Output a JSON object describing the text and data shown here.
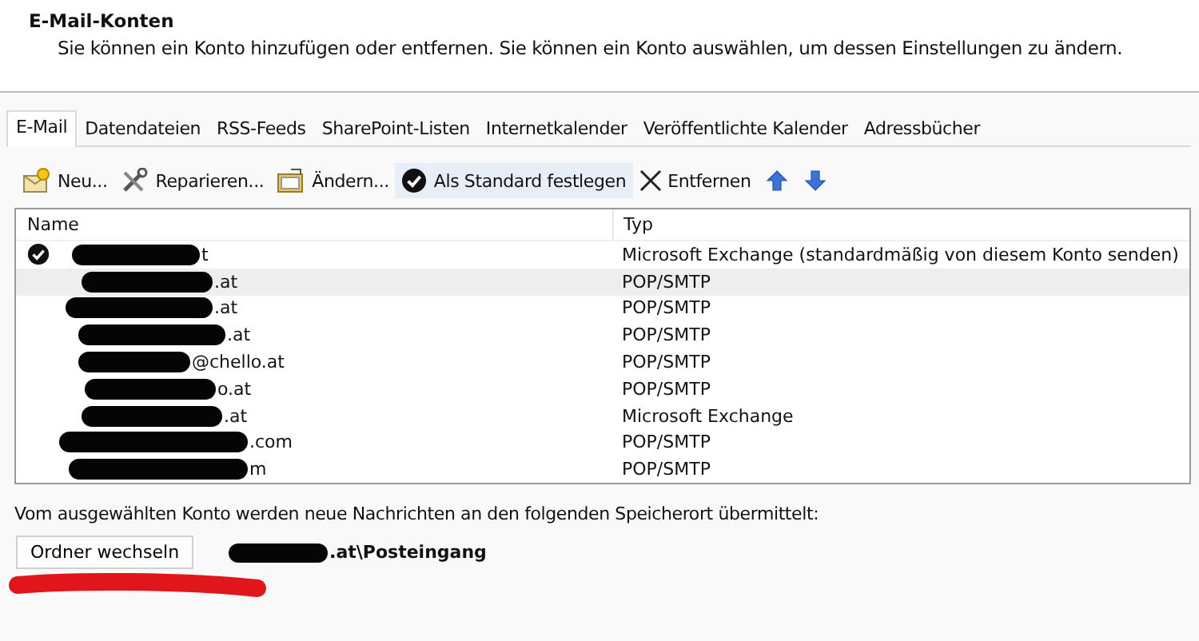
{
  "header": {
    "title": "E-Mail-Konten",
    "description": "Sie können ein Konto hinzufügen oder entfernen. Sie können ein Konto auswählen, um dessen Einstellungen zu ändern."
  },
  "tabs": [
    {
      "label": "E-Mail",
      "selected": true
    },
    {
      "label": "Datendateien",
      "selected": false
    },
    {
      "label": "RSS-Feeds",
      "selected": false
    },
    {
      "label": "SharePoint-Listen",
      "selected": false
    },
    {
      "label": "Internetkalender",
      "selected": false
    },
    {
      "label": "Veröffentlichte Kalender",
      "selected": false
    },
    {
      "label": "Adressbücher",
      "selected": false
    }
  ],
  "toolbar": [
    {
      "kind": "new",
      "label": "Neu..."
    },
    {
      "kind": "repair",
      "label": "Reparieren..."
    },
    {
      "kind": "change",
      "label": "Ändern..."
    },
    {
      "kind": "default",
      "label": "Als Standard festlegen"
    },
    {
      "kind": "remove",
      "label": "Entfernen"
    },
    {
      "kind": "up"
    },
    {
      "kind": "down"
    }
  ],
  "table": {
    "columns": [
      "Name",
      "Typ"
    ],
    "rows": [
      {
        "name": "t",
        "type": "Microsoft Exchange (standardmäßig von diesem Konto senden)",
        "default": true,
        "selected": false
      },
      {
        "name": ".at",
        "type": "POP/SMTP",
        "default": false,
        "selected": true
      },
      {
        "name": ".at",
        "type": "POP/SMTP",
        "default": false,
        "selected": false
      },
      {
        "name": ".at",
        "type": "POP/SMTP",
        "default": false,
        "selected": false
      },
      {
        "name": "@chello.at",
        "type": "POP/SMTP",
        "default": false,
        "selected": false
      },
      {
        "name": "o.at",
        "type": "POP/SMTP",
        "default": false,
        "selected": false
      },
      {
        "name": ".at",
        "type": "Microsoft Exchange",
        "default": false,
        "selected": false
      },
      {
        "name": ".com",
        "type": "POP/SMTP",
        "default": false,
        "selected": false
      },
      {
        "name": "m",
        "type": "POP/SMTP",
        "default": false,
        "selected": false
      }
    ]
  },
  "delivery": {
    "text": "Vom ausgewählten Konto werden neue Nachrichten an den folgenden Speicherort übermittelt:",
    "button": "Ordner wechseln",
    "path": ".at\\Posteingang"
  }
}
